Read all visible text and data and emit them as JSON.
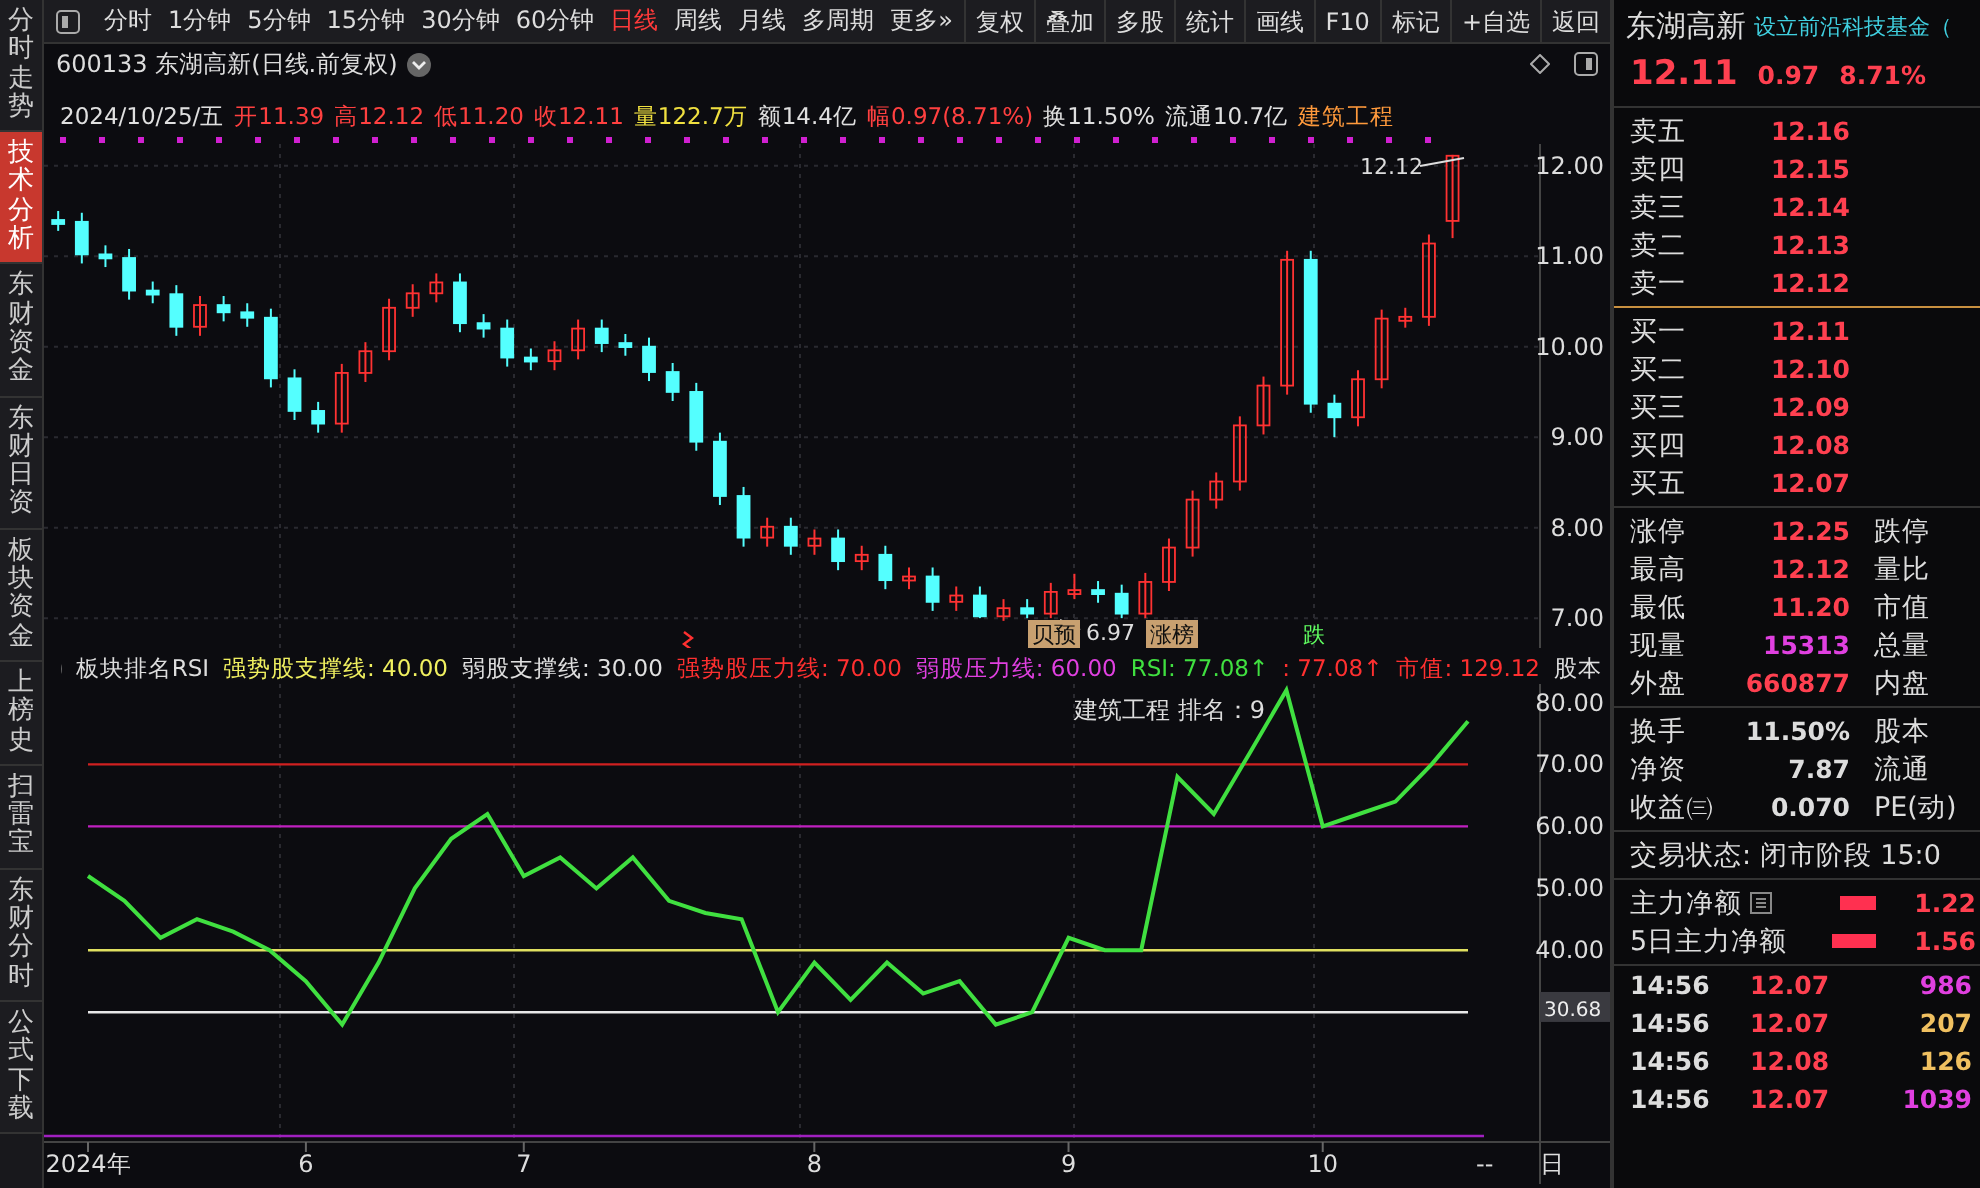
{
  "side_tabs": [
    {
      "label": "分时走势",
      "selected": false
    },
    {
      "label": "技术分析",
      "selected": true
    },
    {
      "label": "东财资金",
      "selected": false
    },
    {
      "label": "东财日资",
      "selected": false
    },
    {
      "label": "板块资金",
      "selected": false
    },
    {
      "label": "上榜史",
      "selected": false
    },
    {
      "label": "扫雷宝",
      "selected": false
    },
    {
      "label": "东财分时",
      "selected": false
    },
    {
      "label": "公式下载",
      "selected": false
    }
  ],
  "period_tabs": [
    {
      "label": "分时",
      "selected": false
    },
    {
      "label": "1分钟",
      "selected": false
    },
    {
      "label": "5分钟",
      "selected": false
    },
    {
      "label": "15分钟",
      "selected": false
    },
    {
      "label": "30分钟",
      "selected": false
    },
    {
      "label": "60分钟",
      "selected": false
    },
    {
      "label": "日线",
      "selected": true
    },
    {
      "label": "周线",
      "selected": false
    },
    {
      "label": "月线",
      "selected": false
    },
    {
      "label": "多周期",
      "selected": false
    },
    {
      "label": "更多»",
      "selected": false
    }
  ],
  "toolbar_buttons": [
    "复权",
    "叠加",
    "多股",
    "统计",
    "画线",
    "F10",
    "标记",
    "+自选",
    "返回"
  ],
  "chart_title": "600133 东湖高新(日线.前复权)",
  "info_line": [
    {
      "text": "2024/10/25/五",
      "color": "#e0e0e0"
    },
    {
      "text": "开11.39",
      "color": "#ff4040"
    },
    {
      "text": "高12.12",
      "color": "#ff4040"
    },
    {
      "text": "低11.20",
      "color": "#ff4040"
    },
    {
      "text": "收12.11",
      "color": "#ff4040"
    },
    {
      "text": "量122.7万",
      "color": "#f0e040"
    },
    {
      "text": "额14.4亿",
      "color": "#e0e0e0"
    },
    {
      "text": "幅0.97(8.71%)",
      "color": "#ff4040"
    },
    {
      "text": "换11.50%",
      "color": "#e0e0e0"
    },
    {
      "text": "流通10.7亿",
      "color": "#e0e0e0"
    },
    {
      "text": "建筑工程",
      "color": "#ff9a3c"
    }
  ],
  "main_chart": {
    "chart_data": {
      "type": "candlestick",
      "ylim": [
        6.67,
        12.24
      ],
      "grid": true,
      "yticks": [
        {
          "value": 12,
          "label": "12.00"
        },
        {
          "value": 11,
          "label": "11.00"
        },
        {
          "value": 10,
          "label": "10.00"
        },
        {
          "value": 9,
          "label": "9.00"
        },
        {
          "value": 8,
          "label": "8.00"
        },
        {
          "value": 7,
          "label": "7.00"
        }
      ],
      "categories": [
        null,
        null,
        null,
        null,
        null,
        null,
        null,
        null,
        null,
        null,
        null,
        null,
        null,
        null,
        null,
        null,
        null,
        null,
        null,
        null,
        null,
        null,
        null,
        null,
        null,
        null,
        null,
        null,
        null,
        null,
        null,
        null,
        null,
        null,
        null,
        null,
        null,
        null,
        null,
        null,
        null,
        null,
        null,
        null,
        null,
        null,
        null,
        null,
        null,
        null,
        null,
        null,
        null,
        null,
        null,
        null,
        null,
        null,
        null,
        null
      ],
      "ohlc": [
        [
          11.4,
          11.5,
          11.28,
          11.38
        ],
        [
          11.38,
          11.48,
          10.92,
          11.02
        ],
        [
          11.02,
          11.12,
          10.88,
          10.98
        ],
        [
          10.98,
          11.08,
          10.52,
          10.62
        ],
        [
          10.62,
          10.72,
          10.48,
          10.58
        ],
        [
          10.58,
          10.68,
          10.12,
          10.22
        ],
        [
          10.22,
          10.56,
          10.12,
          10.46
        ],
        [
          10.46,
          10.56,
          10.28,
          10.38
        ],
        [
          10.38,
          10.48,
          10.22,
          10.32
        ],
        [
          10.32,
          10.42,
          9.55,
          9.65
        ],
        [
          9.65,
          9.75,
          9.19,
          9.29
        ],
        [
          9.29,
          9.39,
          9.05,
          9.15
        ],
        [
          9.15,
          9.81,
          9.05,
          9.71
        ],
        [
          9.71,
          10.05,
          9.61,
          9.95
        ],
        [
          9.95,
          10.53,
          9.85,
          10.43
        ],
        [
          10.43,
          10.69,
          10.33,
          10.59
        ],
        [
          10.59,
          10.81,
          10.49,
          10.71
        ],
        [
          10.71,
          10.81,
          10.16,
          10.26
        ],
        [
          10.26,
          10.36,
          10.1,
          10.2
        ],
        [
          10.2,
          10.3,
          9.78,
          9.88
        ],
        [
          9.88,
          9.98,
          9.74,
          9.84
        ],
        [
          9.84,
          10.06,
          9.74,
          9.96
        ],
        [
          9.96,
          10.3,
          9.86,
          10.2
        ],
        [
          10.2,
          10.3,
          9.94,
          10.04
        ],
        [
          10.04,
          10.14,
          9.9,
          10.0
        ],
        [
          10.0,
          10.1,
          9.62,
          9.72
        ],
        [
          9.72,
          9.82,
          9.4,
          9.5
        ],
        [
          9.5,
          9.6,
          8.85,
          8.95
        ],
        [
          8.95,
          9.05,
          8.25,
          8.35
        ],
        [
          8.35,
          8.45,
          7.79,
          7.89
        ],
        [
          7.89,
          8.11,
          7.79,
          8.01
        ],
        [
          8.01,
          8.11,
          7.7,
          7.8
        ],
        [
          7.8,
          7.98,
          7.7,
          7.88
        ],
        [
          7.88,
          7.98,
          7.53,
          7.63
        ],
        [
          7.63,
          7.8,
          7.53,
          7.7
        ],
        [
          7.7,
          7.8,
          7.32,
          7.42
        ],
        [
          7.42,
          7.56,
          7.32,
          7.46
        ],
        [
          7.46,
          7.56,
          7.08,
          7.18
        ],
        [
          7.18,
          7.35,
          7.08,
          7.25
        ],
        [
          7.25,
          7.35,
          7.0,
          7.02
        ],
        [
          7.02,
          7.21,
          6.97,
          7.11
        ],
        [
          7.11,
          7.21,
          7.0,
          7.05
        ],
        [
          7.05,
          7.39,
          7.0,
          7.29
        ],
        [
          7.29,
          7.49,
          7.21,
          7.31
        ],
        [
          7.31,
          7.41,
          7.17,
          7.27
        ],
        [
          7.27,
          7.37,
          7.0,
          7.05
        ],
        [
          7.05,
          7.5,
          7.0,
          7.4
        ],
        [
          7.4,
          7.88,
          7.3,
          7.78
        ],
        [
          7.78,
          8.41,
          7.68,
          8.31
        ],
        [
          8.31,
          8.61,
          8.21,
          8.51
        ],
        [
          8.51,
          9.23,
          8.41,
          9.13
        ],
        [
          9.13,
          9.67,
          9.03,
          9.57
        ],
        [
          9.57,
          11.06,
          9.47,
          10.96
        ],
        [
          10.96,
          11.06,
          9.27,
          9.37
        ],
        [
          9.37,
          9.47,
          9.0,
          9.22
        ],
        [
          9.22,
          9.74,
          9.12,
          9.64
        ],
        [
          9.64,
          10.41,
          9.54,
          10.31
        ],
        [
          10.31,
          10.43,
          10.21,
          10.33
        ],
        [
          10.33,
          11.24,
          10.23,
          11.14
        ],
        [
          11.39,
          12.12,
          11.2,
          12.11
        ]
      ]
    }
  },
  "price_notes": {
    "high": "12.12",
    "low": "6.97"
  },
  "event_badges": [
    {
      "label": "贝预",
      "kind": "box"
    },
    {
      "label": "涨榜",
      "kind": "box"
    },
    {
      "label": "跌",
      "kind": "green"
    }
  ],
  "indicator": {
    "name": "板块排名RSI",
    "legend": [
      {
        "text": ": 40.00",
        "color": "#f0f060"
      },
      {
        "text": ": 30.00",
        "color": "#e0e0e0"
      },
      {
        "text": ": 70.00",
        "color": "#ff3030"
      },
      {
        "text": ": 60.00",
        "color": "#e040e0"
      },
      {
        "text": ": 77.08↑",
        "color": "#40e040"
      },
      {
        "text": ": 77.08↑",
        "color": "#ff3030"
      },
      {
        "text": "市值: 129.12",
        "color": "#ff3030"
      },
      {
        "text": "股本",
        "color": "#e0e0e0"
      }
    ],
    "rank_note": "建筑工程 排名：9",
    "current": "30.68",
    "chart_data": {
      "type": "line",
      "ylim": [
        10,
        83
      ],
      "yticks": [
        {
          "value": 80,
          "label": "80.00"
        },
        {
          "value": 70,
          "label": "70.00"
        },
        {
          "value": 60,
          "label": "60.00"
        },
        {
          "value": 50,
          "label": "50.00"
        },
        {
          "value": 40,
          "label": "40.00"
        }
      ],
      "categories": [
        "2024年",
        null,
        null,
        null,
        null,
        null,
        "6",
        null,
        null,
        null,
        null,
        null,
        "7",
        null,
        null,
        null,
        null,
        null,
        null,
        null,
        "8",
        null,
        null,
        null,
        null,
        null,
        null,
        "9",
        null,
        null,
        null,
        null,
        null,
        null,
        "10",
        null,
        null,
        null,
        null
      ],
      "series": [
        {
          "name": "强势股支撑线",
          "color": "#e0e060",
          "values": [
            40,
            40,
            40,
            40,
            40,
            40,
            40,
            40,
            40,
            40,
            40,
            40,
            40,
            40,
            40,
            40,
            40,
            40,
            40,
            40,
            40,
            40,
            40,
            40,
            40,
            40,
            40,
            40,
            40,
            40,
            40,
            40,
            40,
            40,
            40,
            40,
            40,
            40,
            40
          ]
        },
        {
          "name": "弱股支撑线",
          "color": "#e8e8e8",
          "values": [
            30,
            30,
            30,
            30,
            30,
            30,
            30,
            30,
            30,
            30,
            30,
            30,
            30,
            30,
            30,
            30,
            30,
            30,
            30,
            30,
            30,
            30,
            30,
            30,
            30,
            30,
            30,
            30,
            30,
            30,
            30,
            30,
            30,
            30,
            30,
            30,
            30,
            30,
            30
          ]
        },
        {
          "name": "强势股压力线",
          "color": "#d02020",
          "values": [
            70,
            70,
            70,
            70,
            70,
            70,
            70,
            70,
            70,
            70,
            70,
            70,
            70,
            70,
            70,
            70,
            70,
            70,
            70,
            70,
            70,
            70,
            70,
            70,
            70,
            70,
            70,
            70,
            70,
            70,
            70,
            70,
            70,
            70,
            70,
            70,
            70,
            70,
            70
          ]
        },
        {
          "name": "弱股压力线",
          "color": "#c020c0",
          "values": [
            60,
            60,
            60,
            60,
            60,
            60,
            60,
            60,
            60,
            60,
            60,
            60,
            60,
            60,
            60,
            60,
            60,
            60,
            60,
            60,
            60,
            60,
            60,
            60,
            60,
            60,
            60,
            60,
            60,
            60,
            60,
            60,
            60,
            60,
            60,
            60,
            60,
            60,
            60
          ]
        },
        {
          "name": "RSI",
          "color": "#40e040",
          "values": [
            52,
            48,
            42,
            45,
            43,
            40,
            35,
            28,
            38,
            50,
            58,
            62,
            52,
            55,
            50,
            55,
            48,
            46,
            45,
            30,
            38,
            32,
            38,
            33,
            35,
            28,
            30,
            42,
            40,
            40,
            68,
            62,
            72,
            82,
            60,
            62,
            64,
            70,
            77
          ]
        }
      ]
    }
  },
  "axis_corner": [
    "--",
    "日"
  ],
  "quote": {
    "name": "东湖高新",
    "news": "设立前沿科技基金（",
    "price": "12.11",
    "change": "0.97",
    "percent": "8.71%"
  },
  "asks": [
    {
      "label": "卖五",
      "price": "12.16"
    },
    {
      "label": "卖四",
      "price": "12.15"
    },
    {
      "label": "卖三",
      "price": "12.14"
    },
    {
      "label": "卖二",
      "price": "12.13"
    },
    {
      "label": "卖一",
      "price": "12.12"
    }
  ],
  "bids": [
    {
      "label": "买一",
      "price": "12.11"
    },
    {
      "label": "买二",
      "price": "12.10"
    },
    {
      "label": "买三",
      "price": "12.09"
    },
    {
      "label": "买四",
      "price": "12.08"
    },
    {
      "label": "买五",
      "price": "12.07"
    }
  ],
  "stats": [
    {
      "label": "涨停",
      "value": "12.25",
      "color": "#ff4050",
      "label2": "跌停"
    },
    {
      "label": "最高",
      "value": "12.12",
      "color": "#ff4050",
      "label2": "量比"
    },
    {
      "label": "最低",
      "value": "11.20",
      "color": "#ff4050",
      "label2": "市值"
    },
    {
      "label": "现量",
      "value": "15313",
      "color": "#e040e0",
      "label2": "总量"
    },
    {
      "label": "外盘",
      "value": "660877",
      "color": "#ff4050",
      "label2": "内盘"
    }
  ],
  "stats2": [
    {
      "label": "换手",
      "value": "11.50%",
      "label2": "股本"
    },
    {
      "label": "净资",
      "value": "7.87",
      "label2": "流通"
    },
    {
      "label": "收益㈢",
      "value": "0.070",
      "label2": "PE(动)"
    }
  ],
  "trade_status": "交易状态: 闭市阶段 15:0",
  "fund_flow": [
    {
      "label": "主力净额",
      "value": "1.22",
      "note_icon": true
    },
    {
      "label": "5日主力净额",
      "value": "1.56",
      "note_icon": false
    }
  ],
  "trades": [
    {
      "time": "14:56",
      "price": "12.07",
      "volume": "986",
      "color": "#e040e0"
    },
    {
      "time": "14:56",
      "price": "12.07",
      "volume": "207",
      "color": "#f0c060"
    },
    {
      "time": "14:56",
      "price": "12.08",
      "volume": "126",
      "color": "#f0c060"
    },
    {
      "time": "14:56",
      "price": "12.07",
      "volume": "1039",
      "color": "#e040e0"
    }
  ]
}
